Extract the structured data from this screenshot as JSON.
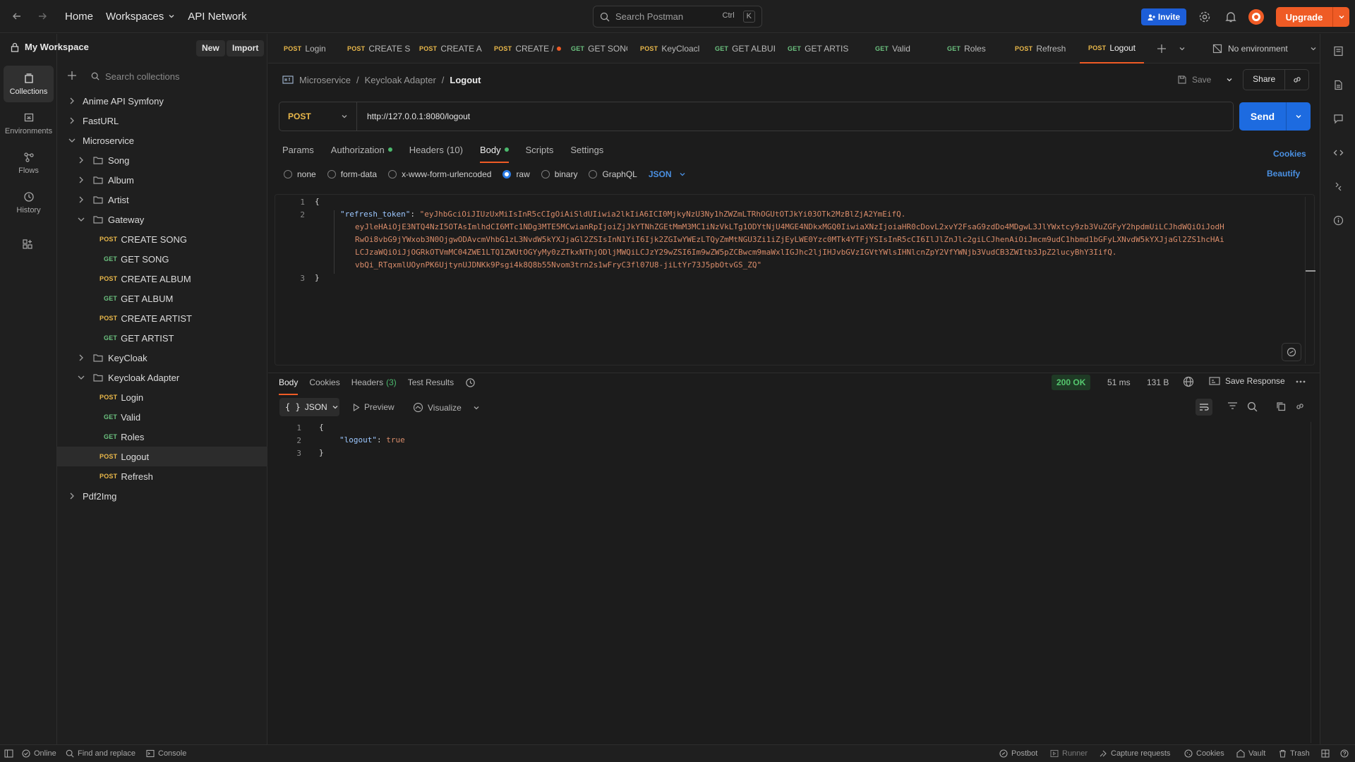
{
  "topbar": {
    "home": "Home",
    "workspaces": "Workspaces",
    "api_network": "API Network",
    "search_placeholder": "Search Postman",
    "kbd_ctrl": "Ctrl",
    "kbd_k": "K",
    "invite": "Invite",
    "upgrade": "Upgrade"
  },
  "rail": {
    "items": [
      {
        "label": "Collections",
        "icon": "collections-icon"
      },
      {
        "label": "Environments",
        "icon": "environments-icon"
      },
      {
        "label": "Flows",
        "icon": "flows-icon"
      },
      {
        "label": "History",
        "icon": "history-icon"
      }
    ]
  },
  "sidebar": {
    "workspace": "My Workspace",
    "new": "New",
    "import": "Import",
    "search_placeholder": "Search collections",
    "tree": [
      {
        "label": "Anime API Symfony"
      },
      {
        "label": "FastURL"
      },
      {
        "label": "Microservice"
      },
      {
        "label": "Song"
      },
      {
        "label": "Album"
      },
      {
        "label": "Artist"
      },
      {
        "label": "Gateway"
      },
      {
        "method": "POST",
        "label": "CREATE SONG"
      },
      {
        "method": "GET",
        "label": "GET SONG"
      },
      {
        "method": "POST",
        "label": "CREATE ALBUM"
      },
      {
        "method": "GET",
        "label": "GET ALBUM"
      },
      {
        "method": "POST",
        "label": "CREATE ARTIST"
      },
      {
        "method": "GET",
        "label": "GET ARTIST"
      },
      {
        "label": "KeyCloak"
      },
      {
        "label": "Keycloak Adapter"
      },
      {
        "method": "POST",
        "label": "Login"
      },
      {
        "method": "GET",
        "label": "Valid"
      },
      {
        "method": "GET",
        "label": "Roles"
      },
      {
        "method": "POST",
        "label": "Logout"
      },
      {
        "method": "POST",
        "label": "Refresh"
      },
      {
        "label": "Pdf2Img"
      }
    ]
  },
  "tabs": [
    {
      "method": "POST",
      "label": "Login"
    },
    {
      "method": "POST",
      "label": "CREATE S"
    },
    {
      "method": "POST",
      "label": "CREATE A"
    },
    {
      "method": "POST",
      "label": "CREATE /"
    },
    {
      "method": "GET",
      "label": "GET SONG"
    },
    {
      "method": "POST",
      "label": "KeyCloacl"
    },
    {
      "method": "GET",
      "label": "GET ALBUI"
    },
    {
      "method": "GET",
      "label": "GET ARTIS"
    },
    {
      "method": "GET",
      "label": "Valid"
    },
    {
      "method": "GET",
      "label": "Roles"
    },
    {
      "method": "POST",
      "label": "Refresh"
    },
    {
      "method": "POST",
      "label": "Logout"
    }
  ],
  "environment": "No environment",
  "breadcrumb": {
    "part1": "Microservice",
    "sep": "/",
    "part2": "Keycloak Adapter",
    "current": "Logout"
  },
  "save": "Save",
  "share": "Share",
  "request": {
    "method": "POST",
    "url": "http://127.0.0.1:8080/logout",
    "send": "Send",
    "tabs": [
      {
        "label": "Params"
      },
      {
        "label": "Authorization"
      },
      {
        "label": "Headers",
        "count": "(10)"
      },
      {
        "label": "Body"
      },
      {
        "label": "Scripts"
      },
      {
        "label": "Settings"
      }
    ],
    "cookies": "Cookies",
    "beautify": "Beautify",
    "body_options": [
      "none",
      "form-data",
      "x-www-form-urlencoded",
      "raw",
      "binary",
      "GraphQL"
    ],
    "body_format": "JSON",
    "body_lines": {
      "n1": "1",
      "n2": "2",
      "n3": "3",
      "open": "{",
      "key": "\"refresh_token\"",
      "colon": ": ",
      "val1": "\"eyJhbGciOiJIUzUxMiIsInR5cCIgOiAiSldUIiwia2lkIiA6ICI0MjkyNzU3Ny1hZWZmLTRhOGUtOTJkYi03OTk2MzBlZjA2YmEifQ.",
      "val2": "eyJleHAiOjE3NTQ4NzI5OTAsImlhdCI6MTc1NDg3MTE5MCwianRpIjoiZjJkYTNhZGEtMmM3MC1iNzVkLTg1ODYtNjU4MGE4NDkxMGQ0IiwiaXNzIjoiaHR0cDovL2xvY2FsaG9zdDo4MDgwL3JlYWxtcy9zb3VuZGFyY2hpdmUiLCJhdWQiOiJodH",
      "val3": "RwOi8vbG9jYWxob3N0OjgwODAvcmVhbG1zL3NvdW5kYXJjaGl2ZSIsInN1YiI6Ijk2ZGIwYWEzLTQyZmMtNGU3Zi1iZjEyLWE0Yzc0MTk4YTFjYSIsInR5cCI6IlJlZnJlc2giLCJhenAiOiJmcm9udC1hbmd1bGFyLXNvdW5kYXJjaGl2ZS1hcHAi",
      "val4": "LCJzaWQiOiJjOGRkOTVmMC04ZWE1LTQ1ZWUtOGYyMy0zZTkxNThjODljMWQiLCJzY29wZSI6Im9wZW5pZCBwcm9maWxlIGJhc2ljIHJvbGVzIGVtYWlsIHNlcnZpY2VfYWNjb3VudCB3ZWItb3JpZ2lucyBhY3IifQ.",
      "val5": "vbQi_RTqxmlUOynPK6UjtynUJDNKk9Psgi4k8Q8b55Nvom3trn2s1wFryC3fl07U8-jiLtYr73J5pbOtvGS_ZQ\"",
      "close": "}"
    }
  },
  "response": {
    "tabs": [
      {
        "label": "Body"
      },
      {
        "label": "Cookies"
      },
      {
        "label": "Headers",
        "count": "(3)"
      },
      {
        "label": "Test Results"
      }
    ],
    "status": "200 OK",
    "time": "51 ms",
    "size": "131 B",
    "save_response": "Save Response",
    "format": "JSON",
    "preview": "Preview",
    "visualize": "Visualize",
    "lines": {
      "n1": "1",
      "n2": "2",
      "n3": "3",
      "open": "{",
      "key": "\"logout\"",
      "colon": ": ",
      "value": "true",
      "close": "}"
    }
  },
  "statusbar": {
    "online": "Online",
    "find_replace": "Find and replace",
    "console": "Console",
    "postbot": "Postbot",
    "runner": "Runner",
    "capture": "Capture requests",
    "cookies": "Cookies",
    "vault": "Vault",
    "trash": "Trash"
  },
  "colors": {
    "accent": "#ef5b25",
    "send": "#1d6be0",
    "post": "#eab84a",
    "get": "#6bc27f",
    "ok": "#55c76e"
  }
}
